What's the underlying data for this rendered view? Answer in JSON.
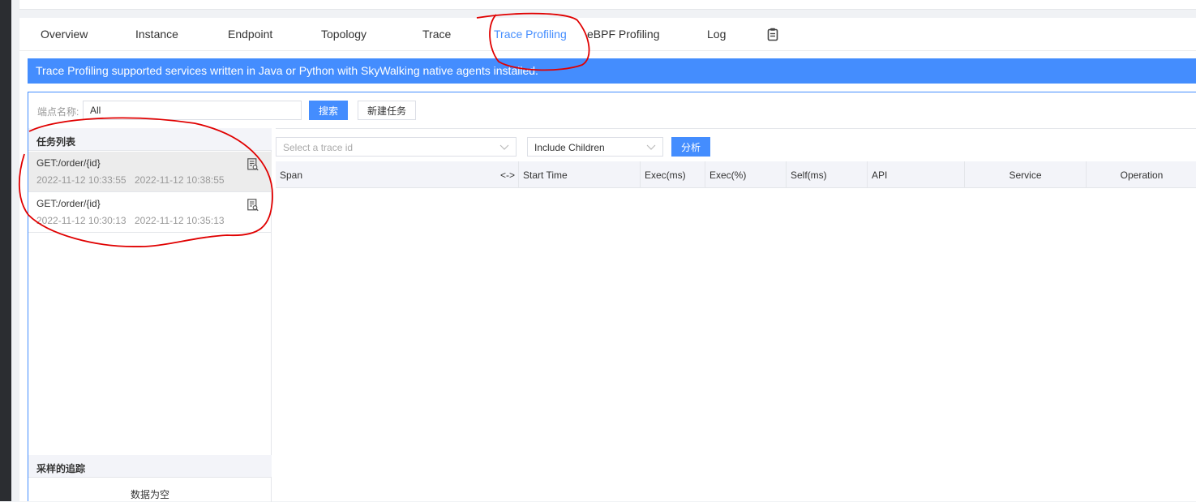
{
  "tabs": [
    "Overview",
    "Instance",
    "Endpoint",
    "Topology",
    "Trace",
    "Trace Profiling",
    "eBPF Profiling",
    "Log"
  ],
  "active_tab": "Trace Profiling",
  "banner_text": "Trace Profiling supported services written in Java or Python with SkyWalking native agents installed.",
  "search": {
    "label": "端点名称:",
    "value": "All",
    "search_button": "搜索",
    "new_task_button": "新建任务"
  },
  "task_list": {
    "header": "任务列表",
    "items": [
      {
        "name": "GET:/order/{id}",
        "start": "2022-11-12 10:33:55",
        "end": "2022-11-12 10:38:55"
      },
      {
        "name": "GET:/order/{id}",
        "start": "2022-11-12 10:30:13",
        "end": "2022-11-12 10:35:13"
      }
    ]
  },
  "sampled": {
    "header": "采样的追踪",
    "empty_text": "数据为空"
  },
  "analysis": {
    "trace_placeholder": "Select a trace id",
    "mode_value": "Include Children",
    "analyze_button": "分析"
  },
  "table": {
    "columns": [
      "Span",
      "Start Time",
      "Exec(ms)",
      "Exec(%)",
      "Self(ms)",
      "API",
      "Service",
      "Operation"
    ],
    "resize_glyph": "<->"
  },
  "colors": {
    "accent": "#448dfe",
    "annotation": "#e00000"
  },
  "icons": [
    "clipboard-icon",
    "task-detail-icon",
    "chevron-down-icon"
  ]
}
